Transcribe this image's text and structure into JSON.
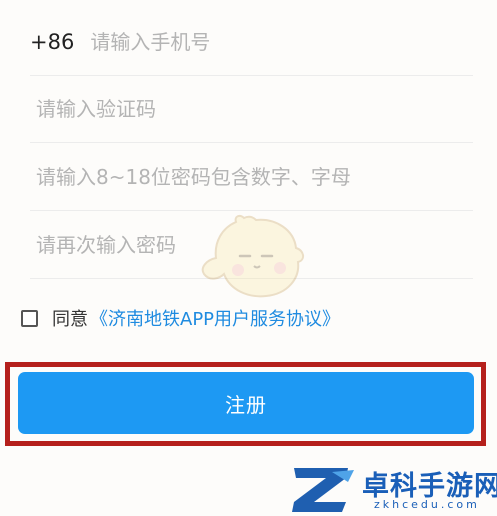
{
  "form": {
    "phone": {
      "prefix": "+86",
      "placeholder": "请输入手机号",
      "value": ""
    },
    "code": {
      "placeholder": "请输入验证码",
      "value": ""
    },
    "password": {
      "placeholder": "请输入8~18位密码包含数字、字母",
      "value": ""
    },
    "confirm": {
      "placeholder": "请再次输入密码",
      "value": ""
    }
  },
  "agreement": {
    "checked": false,
    "text": "同意",
    "link": "《济南地铁APP用户服务协议》"
  },
  "register": {
    "label": "注册"
  },
  "watermark": {
    "title": "卓科手游网",
    "url": "zkhcedu.com"
  },
  "colors": {
    "accent": "#1d99f3",
    "link": "#1f8be0",
    "highlight": "#b5201c",
    "watermark": "#1a5fb8"
  },
  "icons": {
    "mascot": "mascot-icon",
    "checkbox": "checkbox-icon",
    "watermark_logo": "z-logo-icon"
  }
}
